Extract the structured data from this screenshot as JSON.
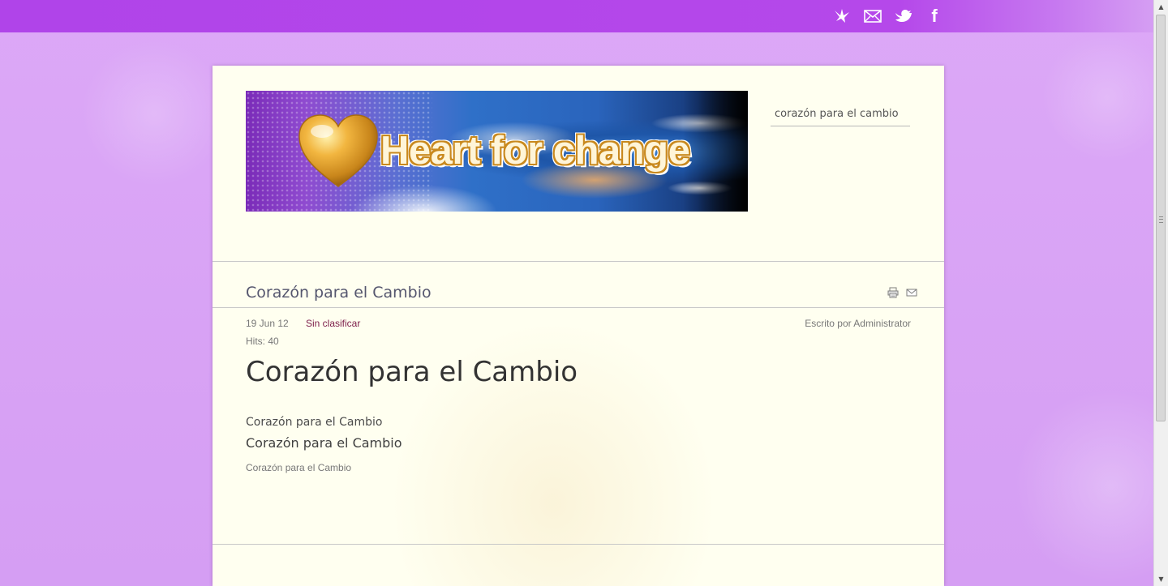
{
  "social": {
    "icons": [
      "dove-icon",
      "mail-icon",
      "twitter-bird-icon",
      "facebook-icon"
    ],
    "facebook_letter": "f"
  },
  "header": {
    "banner_text": "Heart for change",
    "search_value": "corazón para el cambio"
  },
  "article": {
    "title": "Corazón para el Cambio",
    "date": "19 Jun 12",
    "category": "Sin clasificar",
    "author": "Escrito por Administrator",
    "hits": "Hits: 40",
    "heading": "Corazón para el Cambio",
    "lines": [
      "Corazón para el Cambio",
      "Corazón para el Cambio",
      "Corazón para el Cambio"
    ]
  },
  "colors": {
    "top_bar": "#b044e9",
    "page_background": "#d9a6f5",
    "panel_background": "#fffff0",
    "category_link": "#7c1d4a"
  }
}
